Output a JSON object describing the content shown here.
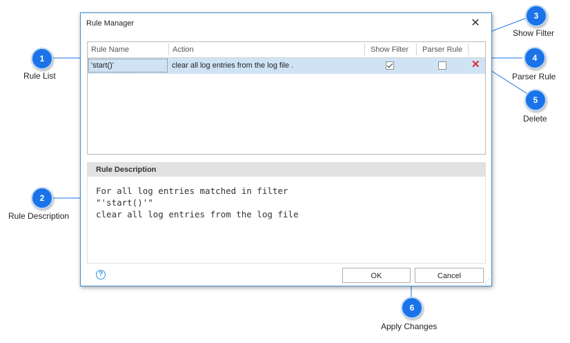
{
  "dialog": {
    "title": "Rule Manager",
    "close_glyph": "✕",
    "grid": {
      "columns": [
        "Rule Name",
        "Action",
        "Show Filter",
        "Parser Rule"
      ],
      "rows": [
        {
          "rule_name": "'start()'",
          "action": "clear all log entries from the log file .",
          "show_filter": true,
          "parser_rule": false,
          "delete_glyph": "✕"
        }
      ]
    },
    "description": {
      "header": "Rule Description",
      "lines": [
        "For all log entries matched in filter",
        "\"'start()'\"",
        "clear all log entries from the log file"
      ]
    },
    "help_glyph": "?",
    "buttons": {
      "ok": "OK",
      "cancel": "Cancel"
    }
  },
  "callouts": [
    {
      "number": "1",
      "label": "Rule List"
    },
    {
      "number": "2",
      "label": "Rule Description"
    },
    {
      "number": "3",
      "label": "Show Filter"
    },
    {
      "number": "4",
      "label": "Parser Rule"
    },
    {
      "number": "5",
      "label": "Delete"
    },
    {
      "number": "6",
      "label": "Apply Changes"
    }
  ],
  "colors": {
    "accent": "#1a73e8",
    "selected_row": "#cfe3f4",
    "delete": "#e0262d",
    "border": "#3b8ed0"
  }
}
